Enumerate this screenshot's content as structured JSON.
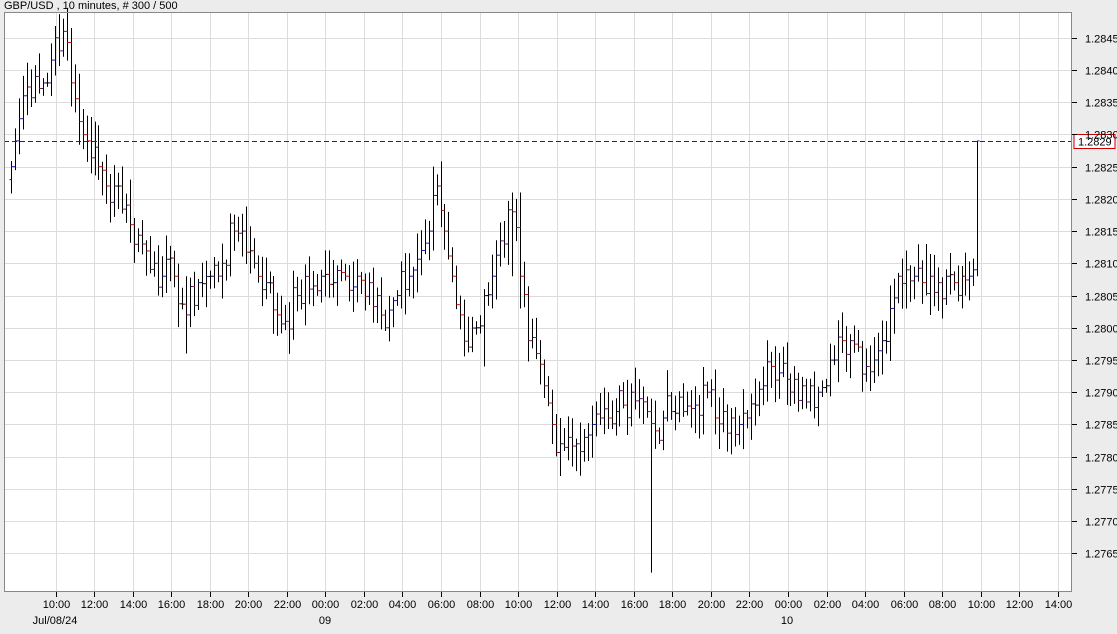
{
  "chart_data": {
    "type": "ohlc",
    "title": "GBP/USD , 10 minutes, # 300 / 500",
    "ylim": [
      1.2759,
      1.2849
    ],
    "y_ticks": [
      "1.2765",
      "1.2770",
      "1.2775",
      "1.2780",
      "1.2785",
      "1.2790",
      "1.2795",
      "1.2800",
      "1.2805",
      "1.2810",
      "1.2815",
      "1.2820",
      "1.2825",
      "1.2830",
      "1.2835",
      "1.2840",
      "1.2845"
    ],
    "x_ticks": [
      "10:00",
      "12:00",
      "14:00",
      "16:00",
      "18:00",
      "20:00",
      "22:00",
      "00:00",
      "02:00",
      "04:00",
      "06:00",
      "08:00",
      "10:00",
      "12:00",
      "14:00",
      "16:00",
      "18:00",
      "20:00",
      "22:00",
      "00:00",
      "02:00",
      "04:00",
      "06:00",
      "08:00",
      "10:00",
      "12:00",
      "14:00"
    ],
    "date_labels": [
      "Jul/08/24",
      "09",
      "10"
    ],
    "current_price": "1.2829",
    "grid": true,
    "colors": {
      "up": "#1a1aa8",
      "down": "#c21818",
      "neutral": "#000000",
      "current_line": "#1a1acc",
      "current_box": "#cc0000",
      "grid": "#dcdcdc",
      "background": "#ffffff"
    },
    "anchors": [
      [
        0,
        1.2825
      ],
      [
        1,
        1.2829
      ],
      [
        3,
        1.2836
      ],
      [
        6,
        1.2839
      ],
      [
        9,
        1.2838
      ],
      [
        11,
        1.2845
      ],
      [
        13,
        1.2846
      ],
      [
        15,
        1.2838
      ],
      [
        17,
        1.2832
      ],
      [
        19,
        1.2829
      ],
      [
        22,
        1.2825
      ],
      [
        24,
        1.2822
      ],
      [
        27,
        1.2822
      ],
      [
        30,
        1.2816
      ],
      [
        33,
        1.2813
      ],
      [
        36,
        1.281
      ],
      [
        38,
        1.2808
      ],
      [
        41,
        1.2808
      ],
      [
        44,
        1.2802
      ],
      [
        47,
        1.2807
      ],
      [
        50,
        1.2808
      ],
      [
        53,
        1.281
      ],
      [
        56,
        1.2815
      ],
      [
        58,
        1.2815
      ],
      [
        61,
        1.281
      ],
      [
        64,
        1.2807
      ],
      [
        67,
        1.2802
      ],
      [
        69,
        1.2801
      ],
      [
        72,
        1.2805
      ],
      [
        75,
        1.2806
      ],
      [
        78,
        1.2808
      ],
      [
        81,
        1.2807
      ],
      [
        84,
        1.2808
      ],
      [
        87,
        1.2808
      ],
      [
        90,
        1.2807
      ],
      [
        92,
        1.2805
      ],
      [
        94,
        1.28
      ],
      [
        97,
        1.2805
      ],
      [
        100,
        1.2808
      ],
      [
        103,
        1.2812
      ],
      [
        105,
        1.2815
      ],
      [
        107,
        1.2822
      ],
      [
        109,
        1.2815
      ],
      [
        111,
        1.2808
      ],
      [
        113,
        1.2802
      ],
      [
        115,
        1.2797
      ],
      [
        117,
        1.28
      ],
      [
        119,
        1.2805
      ],
      [
        121,
        1.2808
      ],
      [
        124,
        1.2813
      ],
      [
        126,
        1.2818
      ],
      [
        128,
        1.2808
      ],
      [
        130,
        1.2798
      ],
      [
        132,
        1.2796
      ],
      [
        134,
        1.2791
      ],
      [
        136,
        1.2785
      ],
      [
        138,
        1.2782
      ],
      [
        140,
        1.2783
      ],
      [
        142,
        1.2782
      ],
      [
        144,
        1.2783
      ],
      [
        146,
        1.2785
      ],
      [
        148,
        1.2786
      ],
      [
        150,
        1.2786
      ],
      [
        152,
        1.2787
      ],
      [
        154,
        1.2788
      ],
      [
        156,
        1.279
      ],
      [
        158,
        1.2789
      ],
      [
        160,
        1.2787
      ],
      [
        162,
        1.2784
      ],
      [
        164,
        1.2786
      ],
      [
        166,
        1.2787
      ],
      [
        169,
        1.2787
      ],
      [
        172,
        1.2788
      ],
      [
        175,
        1.279
      ],
      [
        177,
        1.2786
      ],
      [
        179,
        1.2787
      ],
      [
        181,
        1.2786
      ],
      [
        183,
        1.2785
      ],
      [
        185,
        1.2786
      ],
      [
        187,
        1.2788
      ],
      [
        189,
        1.2791
      ],
      [
        191,
        1.2794
      ],
      [
        193,
        1.2793
      ],
      [
        195,
        1.2792
      ],
      [
        197,
        1.2792
      ],
      [
        199,
        1.2791
      ],
      [
        201,
        1.2791
      ],
      [
        203,
        1.279
      ],
      [
        205,
        1.2791
      ],
      [
        207,
        1.2795
      ],
      [
        209,
        1.2798
      ],
      [
        211,
        1.2798
      ],
      [
        213,
        1.2797
      ],
      [
        215,
        1.2794
      ],
      [
        217,
        1.2795
      ],
      [
        219,
        1.2798
      ],
      [
        221,
        1.2803
      ],
      [
        223,
        1.2808
      ],
      [
        225,
        1.2809
      ],
      [
        227,
        1.2808
      ],
      [
        229,
        1.2807
      ],
      [
        231,
        1.2808
      ],
      [
        233,
        1.2807
      ],
      [
        235,
        1.2808
      ],
      [
        237,
        1.2807
      ],
      [
        239,
        1.2808
      ],
      [
        241,
        1.2808
      ],
      [
        242,
        1.2809
      ],
      [
        243,
        1.2829
      ]
    ],
    "wick_overrides": [
      [
        44,
        1.2796,
        1.2808
      ],
      [
        106,
        1.2812,
        1.2825
      ],
      [
        119,
        1.2794,
        1.2806
      ],
      [
        126,
        1.2808,
        1.2821
      ],
      [
        128,
        1.2803,
        1.2821
      ],
      [
        138,
        1.2777,
        1.2786
      ],
      [
        161,
        1.2762,
        1.2789
      ],
      [
        225,
        1.2803,
        1.2812
      ],
      [
        230,
        1.2805,
        1.2813
      ],
      [
        243,
        1.2808,
        1.2829
      ]
    ]
  }
}
